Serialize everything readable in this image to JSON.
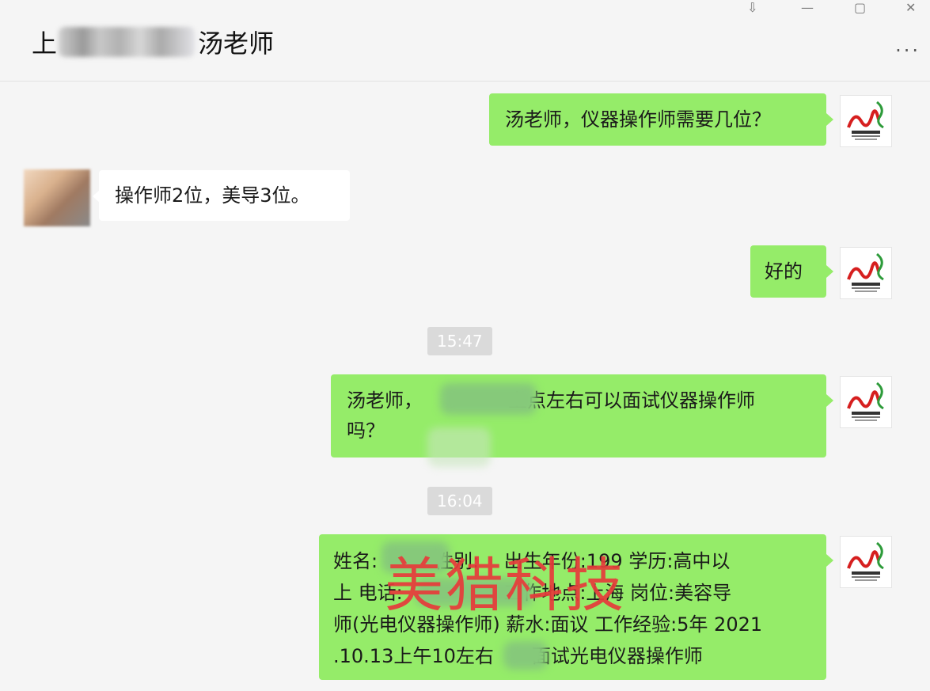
{
  "header": {
    "title_prefix": "上",
    "title_suffix": "汤老师",
    "pin_glyph": "⇩",
    "minimize_glyph": "—",
    "maximize_glyph": "▢",
    "close_glyph": "✕",
    "more_glyph": "···"
  },
  "messages": {
    "m1": "汤老师，仪器操作师需要几位？",
    "m2": "操作师2位，美导3位。",
    "m3": "好的",
    "t1": "15:47",
    "m4_line1_a": "汤老师，",
    "m4_line1_b": "上点左右可以面试仪器操作师",
    "m4_line2": "吗？",
    "t2": "16:04",
    "m5_line1": "姓名:　　　性别:　 出生年份:199  学历:高中以",
    "m5_line2": "上 电话:　　　　　 工作地点:上海 岗位:美容导",
    "m5_line3": "师(光电仪器操作师) 薪水:面议 工作经验:5年 2021",
    "m5_line4": ".10.13上午10左右　　面试光电仪器操作师"
  },
  "watermark": "美猎科技",
  "colors": {
    "bubble_green": "#95ec69",
    "bubble_white": "#ffffff",
    "background": "#f5f5f5",
    "watermark_red": "#e73b3b",
    "logo_red": "#d61f1f",
    "logo_green": "#2d9b3a"
  },
  "icons": {
    "my_avatar": "meilie-logo-icon",
    "contact_avatar": "blurred-photo-avatar"
  }
}
